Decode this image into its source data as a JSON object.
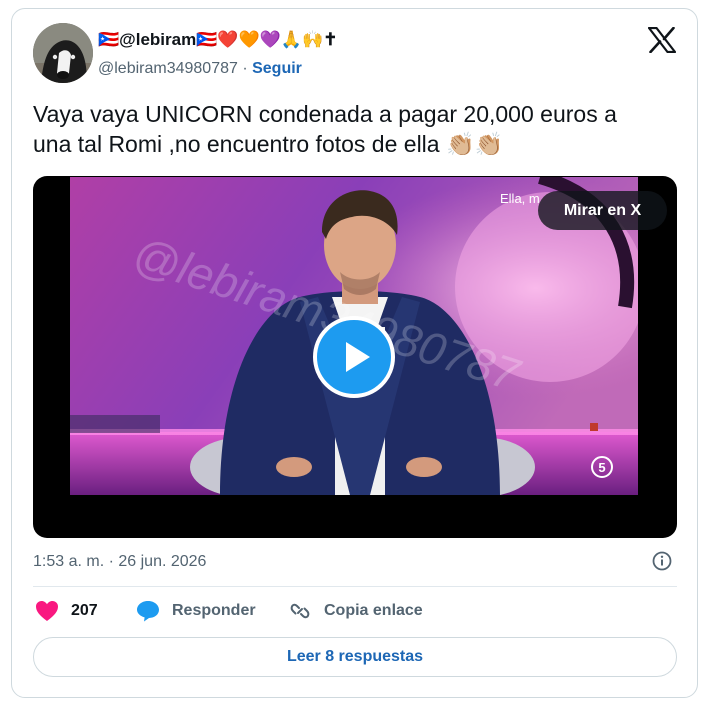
{
  "author": {
    "name_prefix": "🇵🇷",
    "name_main": "@lebiram",
    "name_suffix": "🇵🇷❤️🧡💜🙏🙌✝",
    "handle": "@lebiram34980787",
    "separator": " · ",
    "follow_label": "Seguir"
  },
  "tweet": {
    "text_line1": "Vaya vaya UNICORN condenada a pagar 20,000 euros a",
    "text_line2": "una tal Romi ,no encuentro fotos de ella 👏🏼👏🏼"
  },
  "media": {
    "view_on_x_label": "Mirar en X",
    "video_caption": "Ella, m",
    "watermark": "@lebiram34980787",
    "channel_logo": "5"
  },
  "meta": {
    "timestamp": "1:53 a. m. · 26 jun. 2026"
  },
  "actions": {
    "likes_count": "207",
    "reply_label": "Responder",
    "copy_link_label": "Copia enlace"
  },
  "replies_button_label": "Leer 8 respuestas",
  "colors": {
    "link_blue": "#1d67b5",
    "play_blue": "#1d9bf0",
    "heart_pink": "#f91880",
    "reply_blue": "#1d9bf0",
    "muted_text": "#536471"
  },
  "icons": [
    "x-logo-icon",
    "play-icon",
    "info-icon",
    "heart-icon",
    "reply-bubble-icon",
    "link-icon"
  ]
}
